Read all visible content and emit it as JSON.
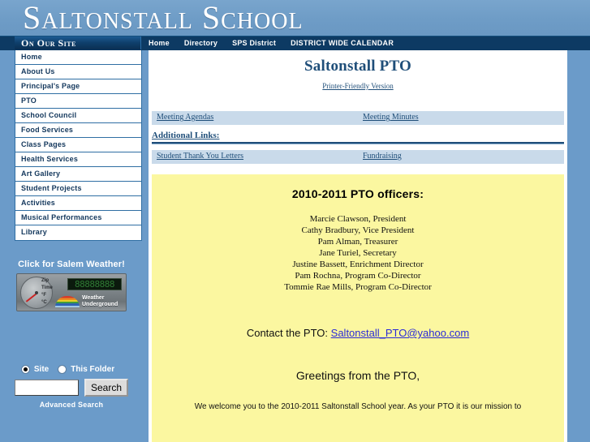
{
  "banner": {
    "title": "Saltonstall School"
  },
  "topnav": {
    "site_tab_label": "On Our Site",
    "links": [
      {
        "label": "Home",
        "caps": false
      },
      {
        "label": "Directory",
        "caps": false
      },
      {
        "label": "SPS District",
        "caps": false
      },
      {
        "label": "DISTRICT WIDE CALENDAR",
        "caps": true
      }
    ]
  },
  "sidebar": {
    "items": [
      {
        "label": "Home"
      },
      {
        "label": "About Us"
      },
      {
        "label": "Principal's Page"
      },
      {
        "label": "PTO"
      },
      {
        "label": "School Council"
      },
      {
        "label": "Food Services"
      },
      {
        "label": "Class Pages"
      },
      {
        "label": "Health Services"
      },
      {
        "label": "Art Gallery"
      },
      {
        "label": "Student Projects"
      },
      {
        "label": "Activities"
      },
      {
        "label": "Musical Performances"
      },
      {
        "label": "Library"
      }
    ],
    "weather": {
      "title": "Click for Salem Weather!",
      "gauge_labels": [
        "Zip",
        "Time",
        "°F",
        "°C"
      ],
      "lcd_text": "88888888",
      "brand_line1": "Weather",
      "brand_line2": "Underground"
    },
    "search": {
      "scope_site_label": "Site",
      "scope_folder_label": "This Folder",
      "scope_selected": "Site",
      "input_value": "",
      "input_placeholder": "",
      "button_label": "Search",
      "advanced_label": "Advanced Search"
    }
  },
  "main": {
    "page_title": "Saltonstall PTO",
    "printer_friendly_label": "Printer-Friendly Version",
    "link_bar_1": [
      {
        "label": "Meeting Agendas"
      },
      {
        "label": "Meeting Minutes"
      }
    ],
    "additional_links_heading": "Additional Links:",
    "link_bar_2": [
      {
        "label": "Student Thank You Letters"
      },
      {
        "label": "Fundraising"
      }
    ],
    "officers_heading": "2010-2011 PTO officers:",
    "officers": [
      "Marcie Clawson, President",
      "Cathy Bradbury, Vice President",
      "Pam Alman, Treasurer",
      "Jane Turiel, Secretary",
      "Justine Bassett, Enrichment Director",
      "Pam Rochna, Program Co-Director",
      "Tommie Rae Mills, Program Co-Director"
    ],
    "contact_prefix": "Contact the PTO:",
    "contact_email": "Saltonstall_PTO@yahoo.com",
    "greetings_heading": "Greetings from the PTO,",
    "intro_paragraph": "We welcome you to the 2010-2011 Saltonstall School year.   As your PTO it is our mission to"
  },
  "colors": {
    "page_background": "#6b9bc9",
    "navbar": "#0d3a63",
    "accent_blue": "#1f4e79",
    "linkbar_background": "#c9daea",
    "yellow_panel": "#fbf7a0",
    "email_link": "#2a2ad8"
  }
}
